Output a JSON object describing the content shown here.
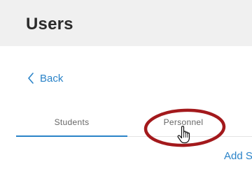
{
  "header": {
    "title": "Users"
  },
  "navigation": {
    "back_label": "Back"
  },
  "tabs": [
    {
      "label": "Students",
      "active": true
    },
    {
      "label": "Personnel",
      "active": false
    }
  ],
  "actions": {
    "add_label": "Add S"
  },
  "colors": {
    "accent": "#2a83c8",
    "header_bg": "#f0f0f0",
    "annotation": "#a3191c"
  },
  "icons": {
    "back": "chevron-left-icon",
    "cursor": "hand-pointer-icon"
  }
}
